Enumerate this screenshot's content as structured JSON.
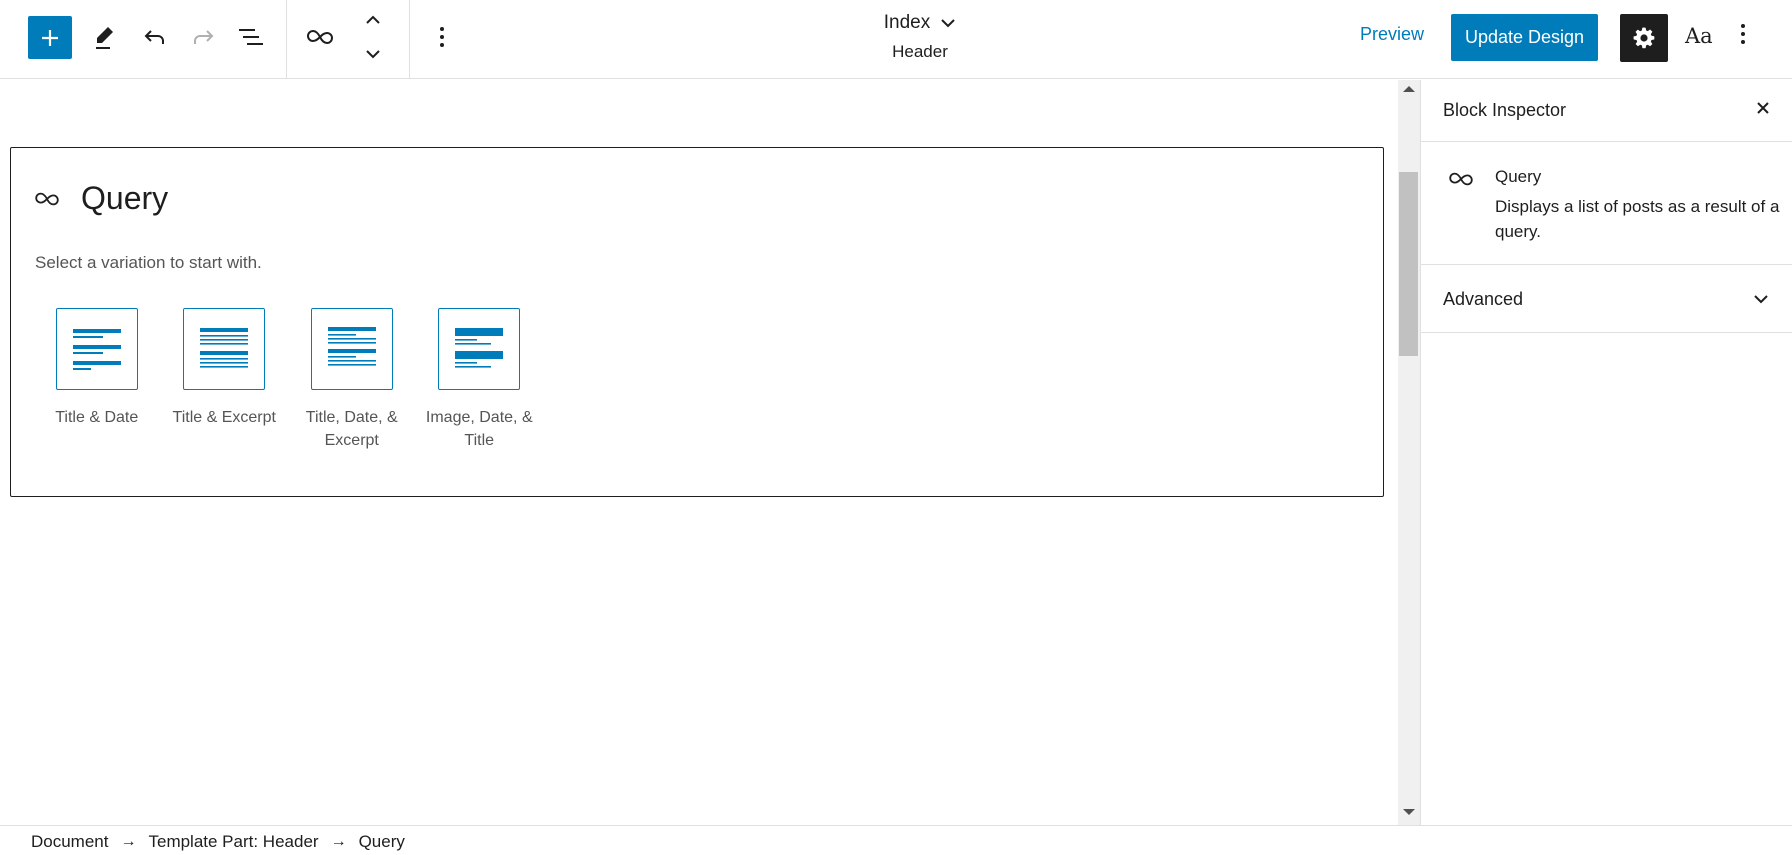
{
  "toolbar": {
    "add_icon": "plus-icon",
    "tools_icon": "pencil-icon",
    "undo_icon": "undo-icon",
    "redo_icon": "redo-icon",
    "list_view_icon": "list-view-icon",
    "block_icon": "query-loop-icon",
    "move_up_icon": "chevron-up-icon",
    "move_down_icon": "chevron-down-icon",
    "options_icon": "more-vertical-icon"
  },
  "document": {
    "title": "Index",
    "subtitle": "Header"
  },
  "actions": {
    "preview_label": "Preview",
    "update_label": "Update Design",
    "settings_icon": "gear-icon",
    "styles_label": "Aa",
    "more_icon": "more-vertical-icon"
  },
  "query_block": {
    "title": "Query",
    "instructions": "Select a variation to start with.",
    "variations": [
      {
        "label": "Title & Date",
        "pattern": "title-date"
      },
      {
        "label": "Title & Excerpt",
        "pattern": "title-excerpt"
      },
      {
        "label": "Title, Date, & Excerpt",
        "pattern": "title-date-excerpt"
      },
      {
        "label": "Image, Date, & Title",
        "pattern": "image-date-title"
      }
    ]
  },
  "sidebar": {
    "title": "Block Inspector",
    "close_icon": "close-icon",
    "block_name": "Query",
    "block_description": "Displays a list of posts as a result of a query.",
    "advanced_label": "Advanced"
  },
  "breadcrumbs": {
    "items": [
      "Document",
      "Template Part: Header",
      "Query"
    ],
    "separator": "→"
  },
  "colors": {
    "accent": "#007cba",
    "dark": "#1e1e1e",
    "border": "#e0e0e0"
  }
}
